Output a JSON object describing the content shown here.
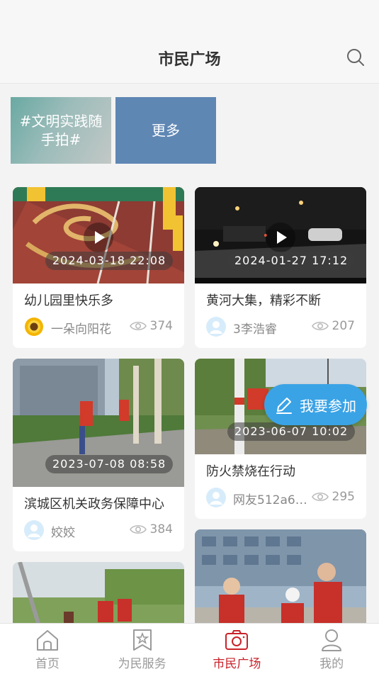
{
  "header": {
    "title": "市民广场"
  },
  "topics": [
    {
      "label": "#文明实践随手拍#"
    },
    {
      "label": "更多"
    }
  ],
  "cards": [
    {
      "date": "2024-03-18 22:08",
      "title": "幼儿园里快乐多",
      "author": "一朵向阳花",
      "views": "374"
    },
    {
      "date": "2024-01-27 17:12",
      "title": "黄河大集，精彩不断",
      "author": "3李浩睿",
      "views": "207"
    },
    {
      "date": "2023-07-08 08:58",
      "title": "滨城区机关政务保障中心",
      "author": "姣姣",
      "views": "384"
    },
    {
      "date": "2023-06-07 10:02",
      "title": "防火禁烧在行动",
      "author": "网友512a6d...",
      "views": "295"
    }
  ],
  "join": {
    "label": "我要参加"
  },
  "tabbar": {
    "items": [
      {
        "label": "首页",
        "icon": "home-icon"
      },
      {
        "label": "为民服务",
        "icon": "bookmark-star-icon"
      },
      {
        "label": "市民广场",
        "icon": "camera-icon",
        "active": true
      },
      {
        "label": "我的",
        "icon": "user-icon"
      }
    ]
  },
  "colors": {
    "accent": "#c9222a",
    "join_button": "#3aa3e6",
    "topic_more": "#5f87b4"
  }
}
